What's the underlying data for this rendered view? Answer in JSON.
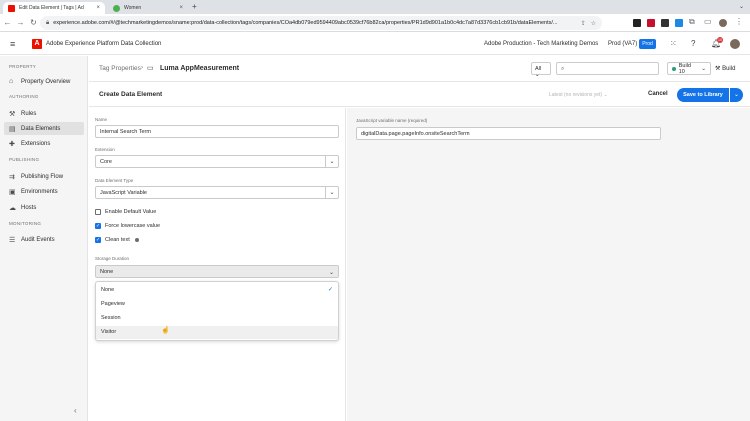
{
  "browser": {
    "tabs": [
      {
        "title": "Edit Data Element | Tags | Ad",
        "favicon_color": "#eb1000"
      },
      {
        "title": "Women",
        "favicon_color": "#4caf50"
      }
    ],
    "url": "experience.adobe.com/#/@techmarketingdemos/sname:prod/data-collection/tags/companies/COa4db079ed9594409abc0539cf76b82ca/properties/PR1d9d901a1b0c4dc7a87d3376cb1cb91b/dataElements/..."
  },
  "app": {
    "title": "Adobe Experience Platform Data Collection",
    "org": "Adobe Production - Tech Marketing Demos",
    "env_label": "Prod (VA7)",
    "env_badge": "Prod",
    "notification_count": "10",
    "brand_color": "#eb1000",
    "accent_color": "#1473e6"
  },
  "sidebar": {
    "sections": [
      {
        "label": "PROPERTY"
      },
      {
        "label": "AUTHORING"
      },
      {
        "label": "PUBLISHING"
      },
      {
        "label": "MONITORING"
      }
    ],
    "items": [
      {
        "label": "Property Overview",
        "icon": "home-icon"
      },
      {
        "label": "Rules",
        "icon": "rules-icon"
      },
      {
        "label": "Data Elements",
        "icon": "data-elements-icon",
        "selected": true
      },
      {
        "label": "Extensions",
        "icon": "extensions-icon"
      },
      {
        "label": "Publishing Flow",
        "icon": "publishing-flow-icon"
      },
      {
        "label": "Environments",
        "icon": "environments-icon"
      },
      {
        "label": "Hosts",
        "icon": "hosts-icon"
      },
      {
        "label": "Audit Events",
        "icon": "audit-events-icon"
      }
    ]
  },
  "subheader": {
    "crumb_root": "Tag Properties",
    "property_name": "Luma AppMeasurement",
    "filter_value": "All",
    "search_placeholder": "",
    "build_label": "Build 10",
    "build_button": "Build"
  },
  "editor": {
    "title": "Create Data Element",
    "library_select": "Latest (no revisions yet)",
    "cancel_label": "Cancel",
    "save_label": "Save to Library"
  },
  "form": {
    "name_label": "Name",
    "name_value": "Internal Search Term",
    "extension_label": "Extension",
    "extension_value": "Core",
    "type_label": "Data Element Type",
    "type_value": "JavaScript Variable",
    "enable_default_label": "Enable Default Value",
    "force_lowercase_label": "Force lowercase value",
    "clean_text_label": "Clean text",
    "storage_label": "Storage Duration",
    "storage_value": "None",
    "storage_options": [
      "None",
      "Pageview",
      "Session",
      "Visitor"
    ]
  },
  "settings": {
    "var_label": "JavaScript variable name (required)",
    "var_value": "digitalData.page.pageInfo.onsiteSearchTerm"
  }
}
